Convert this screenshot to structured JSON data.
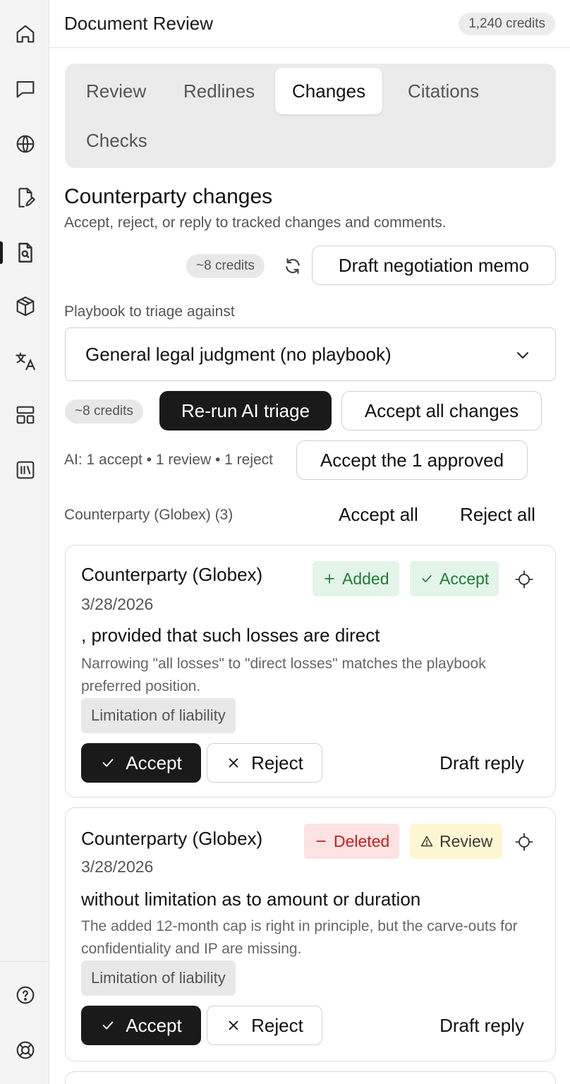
{
  "sidebar": {
    "icons": [
      "home-icon",
      "chat-icon",
      "globe-icon",
      "document-edit-icon",
      "document-search-icon",
      "cube-icon",
      "translate-icon",
      "layout-icon",
      "library-icon"
    ],
    "bottom_icons": [
      "help-icon",
      "support-icon"
    ],
    "active": "document-search-icon"
  },
  "header": {
    "title": "Document Review",
    "credits": "1,240 credits"
  },
  "tabs": [
    {
      "label": "Review",
      "active": false
    },
    {
      "label": "Redlines",
      "active": false
    },
    {
      "label": "Changes",
      "active": true
    },
    {
      "label": "Citations",
      "active": false
    },
    {
      "label": "Checks",
      "active": false
    }
  ],
  "section": {
    "title": "Counterparty changes",
    "subtitle": "Accept, reject, or reply to tracked changes and comments.",
    "memo_credits": "~8 credits",
    "memo_button": "Draft negotiation memo"
  },
  "playbook": {
    "label": "Playbook to triage against",
    "selected": "General legal judgment (no playbook)"
  },
  "triage": {
    "credits": "~8 credits",
    "rerun_button": "Re-run AI triage",
    "accept_all_button": "Accept all changes",
    "summary": "AI: 1 accept • 1 review • 1 reject",
    "accept_approved_button": "Accept the 1 approved"
  },
  "group": {
    "label": "Counterparty (Globex) (3)",
    "accept_all": "Accept all",
    "reject_all": "Reject all"
  },
  "changes": [
    {
      "author": "Counterparty (Globex)",
      "date": "3/28/2026",
      "change_badge": "Added",
      "ai_badge": "Accept",
      "text": ", provided that such losses are direct",
      "rationale": "Narrowing \"all losses\" to \"direct losses\" matches the playbook preferred position.",
      "tag": "Limitation of liability",
      "accept_label": "Accept",
      "reject_label": "Reject",
      "reply_label": "Draft reply"
    },
    {
      "author": "Counterparty (Globex)",
      "date": "3/28/2026",
      "change_badge": "Deleted",
      "ai_badge": "Review",
      "text": "without limitation as to amount or duration",
      "rationale": "The added 12-month cap is right in principle, but the carve-outs for confidentiality and IP are missing.",
      "tag": "Limitation of liability",
      "accept_label": "Accept",
      "reject_label": "Reject",
      "reply_label": "Draft reply"
    }
  ],
  "colors": {
    "added_green": "#1f7a3a",
    "deleted_red": "#c81e1e",
    "review_yellow": "#fdf6d2",
    "primary_dark": "#1a1a1a"
  }
}
